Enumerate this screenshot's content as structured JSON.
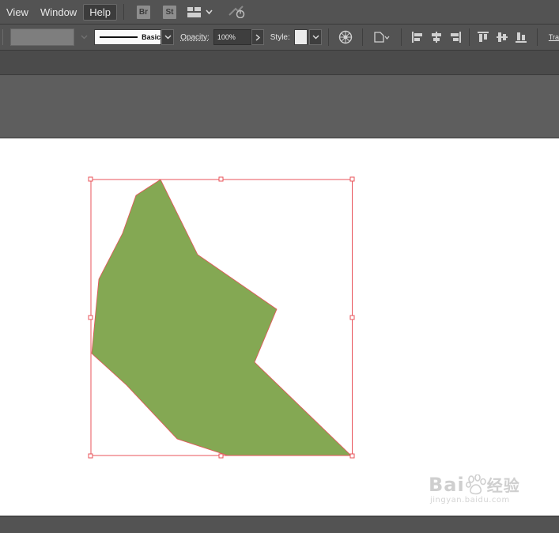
{
  "menubar": {
    "items": [
      {
        "label": "View"
      },
      {
        "label": "Window"
      },
      {
        "label": "Help"
      }
    ],
    "bridge_badge": "Br",
    "stock_badge": "St",
    "icons": [
      "workspace-layout-icon",
      "chevron-down-icon",
      "gpu-performance-icon"
    ]
  },
  "controlbar": {
    "fill_color": "#7e7e7e",
    "stroke_profile": "Basic",
    "opacity_label": "Opacity:",
    "opacity_value": "100%",
    "style_label": "Style:",
    "style_swatch": "#ececec",
    "transform_label": "Tra",
    "icons": [
      "recolor-artwork-icon",
      "align-to-icon",
      "align-left-icon",
      "align-horizontal-center-icon",
      "align-right-icon",
      "align-top-icon",
      "align-vertical-center-icon",
      "align-bottom-icon"
    ]
  },
  "canvas": {
    "artboard_color": "#ffffff",
    "shape_fill": "#84a853",
    "selection_color": "#e8535a"
  },
  "watermark": {
    "brand_left": "Bai",
    "brand_right": "经验",
    "sub": "jingyan.baidu.com"
  }
}
